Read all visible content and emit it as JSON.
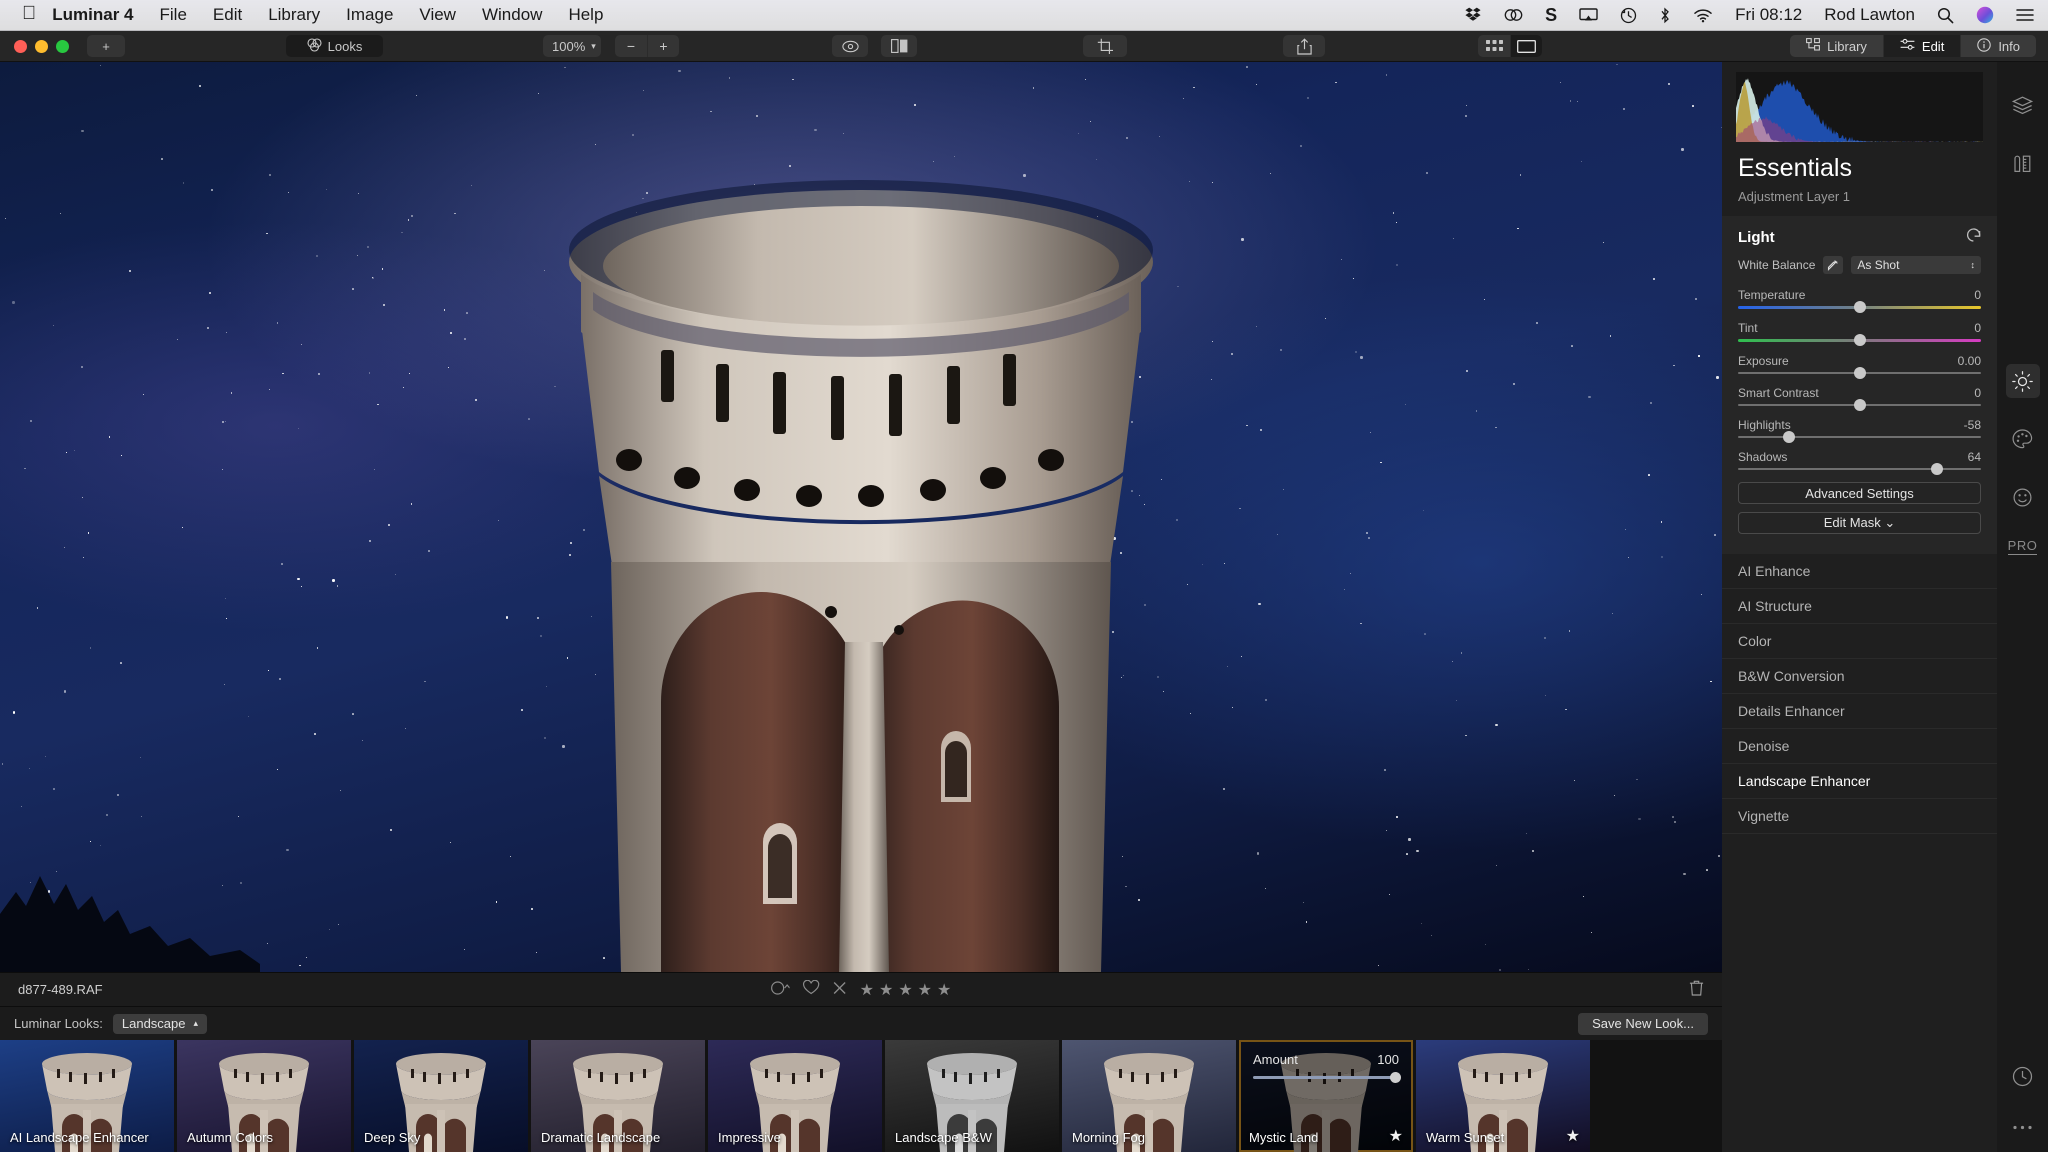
{
  "menubar": {
    "apple_icon": "apple-icon",
    "app_name": "Luminar 4",
    "items": [
      "File",
      "Edit",
      "Library",
      "Image",
      "View",
      "Window",
      "Help"
    ],
    "status_icons": [
      "dropbox-icon",
      "creative-cloud-icon",
      "s-app-icon",
      "airplay-icon",
      "time-machine-icon",
      "bluetooth-icon",
      "wifi-icon"
    ],
    "clock": "Fri 08:12",
    "user": "Rod Lawton",
    "search_icon": "spotlight-search-icon",
    "siri_icon": "siri-icon",
    "control_center_icon": "control-center-icon"
  },
  "toolbar": {
    "add_label": "+",
    "looks_label": "Looks",
    "looks_icon": "looks-venn-icon",
    "zoom_value": "100%",
    "zoom_out_label": "−",
    "zoom_in_label": "+",
    "preview_icon": "eye-icon",
    "compare_icon": "split-compare-icon",
    "crop_icon": "crop-icon",
    "share_icon": "share-icon",
    "grid_view_icon": "grid-view-icon",
    "single_view_icon": "single-view-icon",
    "tabs": [
      {
        "label": "Library",
        "icon": "library-icon",
        "active": false
      },
      {
        "label": "Edit",
        "icon": "sliders-icon",
        "active": true
      },
      {
        "label": "Info",
        "icon": "info-icon",
        "active": false
      }
    ]
  },
  "panel": {
    "title": "Essentials",
    "subtitle": "Adjustment Layer 1",
    "histogram_name": "rgb-histogram",
    "light": {
      "heading": "Light",
      "reset_icon": "reset-arrow-icon",
      "white_balance_label": "White Balance",
      "eyedropper_icon": "eyedropper-icon",
      "white_balance_value": "As Shot",
      "chevron_icon": "chevron-updown-icon",
      "sliders": [
        {
          "label": "Temperature",
          "value": "0",
          "pos": 50,
          "kind": "temp"
        },
        {
          "label": "Tint",
          "value": "0",
          "pos": 50,
          "kind": "tint"
        },
        {
          "label": "Exposure",
          "value": "0.00",
          "pos": 50,
          "kind": "plain"
        },
        {
          "label": "Smart Contrast",
          "value": "0",
          "pos": 50,
          "kind": "plain"
        },
        {
          "label": "Highlights",
          "value": "-58",
          "pos": 21,
          "kind": "plain"
        },
        {
          "label": "Shadows",
          "value": "64",
          "pos": 82,
          "kind": "plain"
        }
      ],
      "advanced_label": "Advanced Settings",
      "edit_mask_label": "Edit Mask ⌄"
    },
    "filters": [
      {
        "label": "AI Enhance",
        "active": false
      },
      {
        "label": "AI Structure",
        "active": false
      },
      {
        "label": "Color",
        "active": false
      },
      {
        "label": "B&W Conversion",
        "active": false
      },
      {
        "label": "Details Enhancer",
        "active": false
      },
      {
        "label": "Denoise",
        "active": false
      },
      {
        "label": "Landscape Enhancer",
        "active": true
      },
      {
        "label": "Vignette",
        "active": false
      }
    ]
  },
  "rail": {
    "icons": [
      {
        "name": "layers-icon",
        "active": false
      },
      {
        "name": "tools-ruler-icon",
        "active": false
      },
      {
        "name": "essentials-sun-icon",
        "active": true
      },
      {
        "name": "creative-palette-icon",
        "active": false
      },
      {
        "name": "portrait-face-icon",
        "active": false
      }
    ],
    "pro_label": "PRO",
    "history_icon": "history-clock-icon",
    "more_icon": "more-dots-icon"
  },
  "status": {
    "filename": "d877-489.RAF",
    "flag_icon": "flag-circle-icon",
    "heart_icon": "heart-icon",
    "reject_icon": "reject-x-icon",
    "stars": [
      "★",
      "★",
      "★",
      "★",
      "★"
    ],
    "trash_icon": "trash-icon"
  },
  "looks_bar": {
    "label": "Luminar Looks:",
    "category": "Landscape",
    "category_chevron": "chevron-up-icon",
    "save_label": "Save New Look..."
  },
  "looks": [
    {
      "label": "AI Landscape Enhancer",
      "selected": false,
      "favorite": false,
      "tint": "#1d3f86",
      "tint2": "#0d1c46"
    },
    {
      "label": "Autumn Colors",
      "selected": false,
      "favorite": false,
      "tint": "#3b3560",
      "tint2": "#191430"
    },
    {
      "label": "Deep Sky",
      "selected": false,
      "favorite": false,
      "tint": "#13224e",
      "tint2": "#070e28"
    },
    {
      "label": "Dramatic Landscape",
      "selected": false,
      "favorite": false,
      "tint": "#4a4458",
      "tint2": "#221f2c"
    },
    {
      "label": "Impressive",
      "selected": false,
      "favorite": false,
      "tint": "#2d2a57",
      "tint2": "#121028"
    },
    {
      "label": "Landscape B&W",
      "selected": false,
      "favorite": false,
      "tint": "#3a3a3a",
      "tint2": "#111111"
    },
    {
      "label": "Morning Fog",
      "selected": false,
      "favorite": false,
      "tint": "#4e5570",
      "tint2": "#22263a"
    },
    {
      "label": "Mystic Land",
      "selected": true,
      "favorite": true,
      "tint": "#151d33",
      "tint2": "#05080f",
      "amount_label": "Amount",
      "amount_value": "100"
    },
    {
      "label": "Warm Sunset",
      "selected": false,
      "favorite": true,
      "tint": "#2b3c7c",
      "tint2": "#120d22"
    }
  ],
  "colors": {
    "accent_selected": "#d99a28",
    "panel_bg": "#1f1f1f",
    "toolbar_bg": "#262626"
  }
}
